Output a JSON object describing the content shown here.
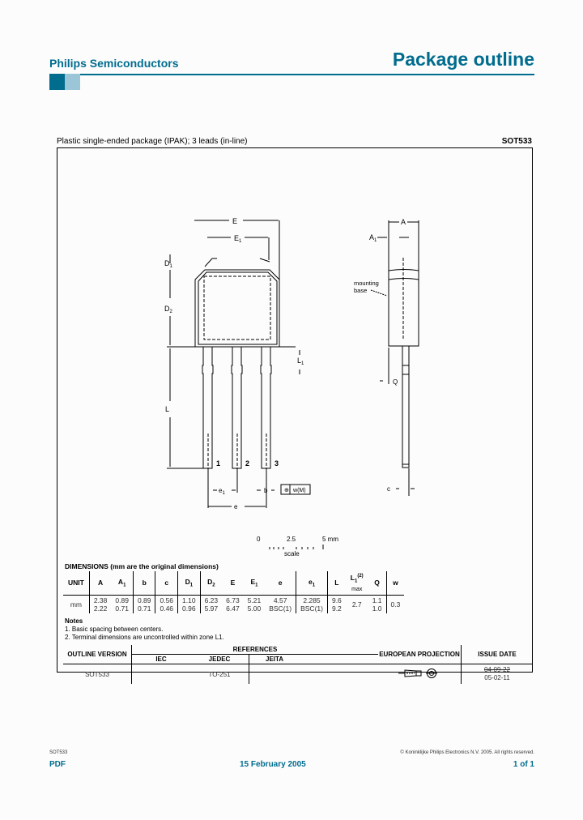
{
  "header": {
    "brand": "Philips Semiconductors",
    "page_title": "Package outline",
    "accent_color": "#006c8e",
    "accent_light": "#9bc6d8"
  },
  "drawing": {
    "title": "Plastic single-ended package (IPAK); 3 leads (in-line)",
    "code": "SOT533",
    "labels": {
      "E": "E",
      "E1": "E",
      "D1": "D",
      "D2": "D",
      "L": "L",
      "L1": "L",
      "e": "e",
      "e1": "e",
      "b": "b",
      "w": "w",
      "A": "A",
      "A1": "A",
      "Q": "Q",
      "c": "c",
      "sub1": "1",
      "sub2": "2",
      "pin1": "1",
      "pin2": "2",
      "pin3": "3",
      "mounting_base": [
        "mounting",
        "base"
      ],
      "tolerance_frame": "w",
      "tolerance_ref": "M"
    },
    "scale": {
      "ticks": [
        "0",
        "2.5",
        "5 mm"
      ],
      "label": "scale"
    }
  },
  "dimensions": {
    "title": "DIMENSIONS (mm are the original dimensions)",
    "headers": [
      "UNIT",
      "A",
      "A1",
      "b",
      "c",
      "D1",
      "D2",
      "E",
      "E1",
      "e",
      "e1",
      "L",
      "L1(2) max",
      "Q",
      "w"
    ],
    "unit": "mm",
    "rows": {
      "A": [
        "2.38",
        "2.22"
      ],
      "A1": [
        "0.89",
        "0.71"
      ],
      "b": [
        "0.89",
        "0.71"
      ],
      "c": [
        "0.56",
        "0.46"
      ],
      "D1": [
        "1.10",
        "0.96"
      ],
      "D2": [
        "6.23",
        "5.97"
      ],
      "E": [
        "6.73",
        "6.47"
      ],
      "E1": [
        "5.21",
        "5.00"
      ],
      "e": [
        "4.57",
        "BSC(1)"
      ],
      "e1": [
        "2.285",
        "BSC(1)"
      ],
      "L": [
        "9.6",
        "9.2"
      ],
      "L1": "2.7",
      "Q": [
        "1.1",
        "1.0"
      ],
      "w": "0.3"
    }
  },
  "notes": {
    "title": "Notes",
    "items": [
      "1. Basic spacing between centers.",
      "2. Terminal dimensions are uncontrolled within zone L1."
    ]
  },
  "references": {
    "headers": {
      "outline_version": "OUTLINE VERSION",
      "references": "REFERENCES",
      "iec": "IEC",
      "jedec": "JEDEC",
      "jeita": "JEITA",
      "european_projection": "EUROPEAN PROJECTION",
      "issue_date": "ISSUE DATE"
    },
    "row": {
      "outline_version": "SOT533",
      "iec": "",
      "jedec": "TO-251",
      "jeita": "",
      "issue_dates": [
        "04-09-22",
        "05-02-11"
      ]
    }
  },
  "footer": {
    "doc_code": "SOT533",
    "copyright": "© Koninklijke Philips Electronics N.V. 2005. All rights reserved.",
    "format": "PDF",
    "date": "15 February 2005",
    "page": "1 of 1"
  }
}
